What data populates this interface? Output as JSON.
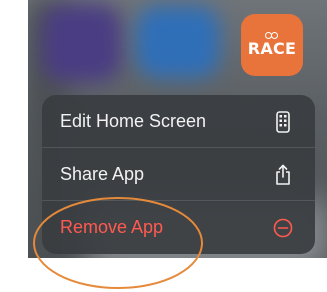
{
  "app_icon": {
    "name": "RACE",
    "color": "#e9743b",
    "icon": "two-rings-logo"
  },
  "context_menu": {
    "items": [
      {
        "label": "Edit Home Screen",
        "icon": "phone-apps-icon",
        "color": "#f2f2f2"
      },
      {
        "label": "Share App",
        "icon": "share-icon",
        "color": "#f2f2f2"
      },
      {
        "label": "Remove App",
        "icon": "minus-circle-icon",
        "color": "#ff5a4f"
      }
    ]
  },
  "annotation": {
    "shape": "ellipse",
    "color": "#e58a3a",
    "target": "Remove App"
  }
}
